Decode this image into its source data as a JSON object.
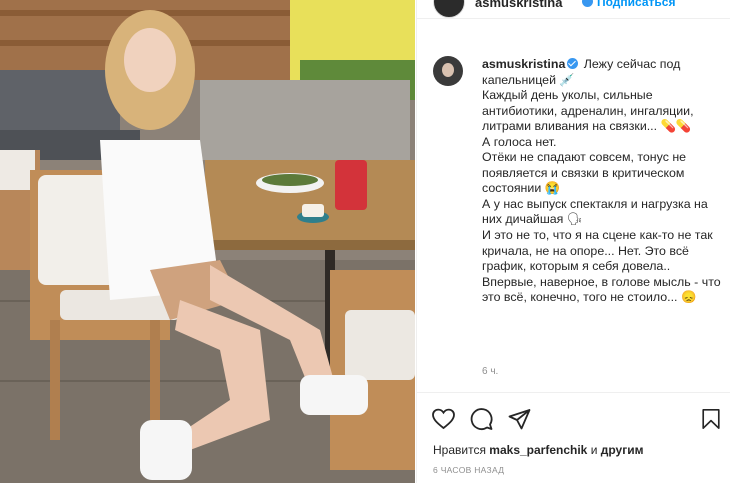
{
  "header": {
    "username": "asmuskristina",
    "follow_label": "Подписаться"
  },
  "post": {
    "image_alt": "Photo of a young woman in a white shirt and beige shorts seated at a restaurant table",
    "caption_username": "asmuskristina",
    "caption_text": "Лежу сейчас под капельницей 💉\nКаждый день уколы, сильные антибиотики, адреналин, ингаляции, литрами вливания на связки... 💊💊\nА голоса нет.\nОтёки не спадают совсем, тонус не появляется и связки в критическом состоянии 😭\nА у нас выпуск спектакля и нагрузка на них дичайшая 🗣\nИ это не то, что я на сцене как-то не так кричала, не на опоре... Нет. Это всё график, которым я себя довела.. Впервые, наверное, в голове мысль - что это всё, конечно, того не стоило... 😞",
    "time_short": "6 ч.",
    "likes_prefix": "Нравится ",
    "likes_user": "maks_parfenchik",
    "likes_suffix": " и другим",
    "time_ago": "6 ЧАСОВ НАЗАД"
  },
  "icons": {
    "like": "heart-icon",
    "comment": "comment-icon",
    "share": "share-icon",
    "save": "bookmark-icon",
    "verified": "verified-badge-icon"
  },
  "colors": {
    "link_blue": "#0095f6",
    "verified_blue": "#3897f0",
    "text": "#262626",
    "muted": "#8e8e8e"
  }
}
